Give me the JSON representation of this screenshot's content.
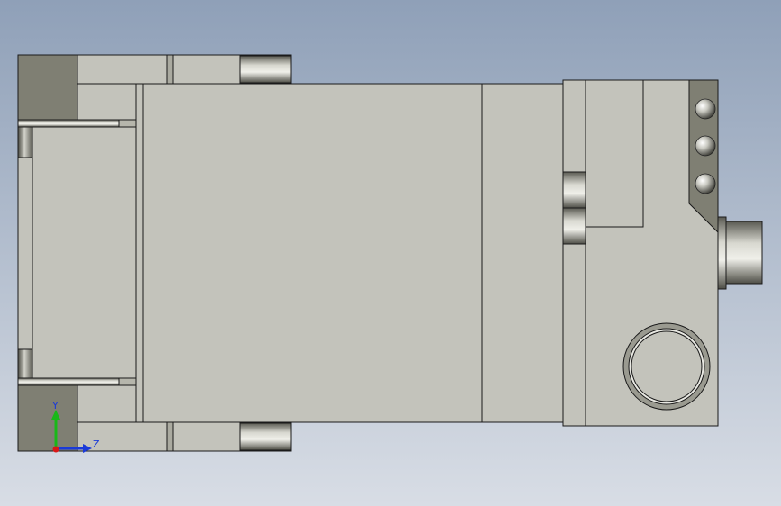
{
  "viewport": {
    "background_top": "#8fa0b8",
    "background_bottom": "#d8dde5"
  },
  "part_colors": {
    "face_light": "#c3c3bb",
    "face_mid": "#b6b6ac",
    "face_dark": "#7f7f73",
    "edge": "#1a1a1a",
    "metal_light": "#e6e6e0",
    "metal_dark": "#55554d"
  },
  "axis_triad": {
    "y_label": "Y",
    "z_label": "Z",
    "y_color": "#18b818",
    "z_color": "#1a3ad8",
    "x_color": "#d81818"
  }
}
